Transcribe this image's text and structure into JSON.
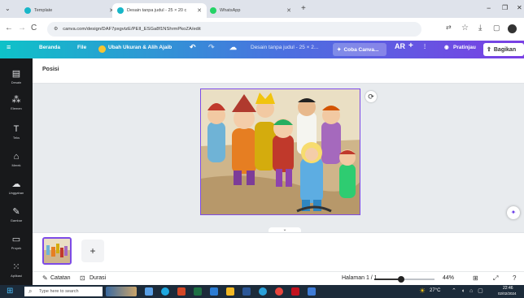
{
  "browser": {
    "tabs": [
      {
        "label": "Template",
        "active": false
      },
      {
        "label": "Desain tanpa judul - 25 × 20 c",
        "active": true
      },
      {
        "label": "WhatsApp",
        "active": false
      }
    ],
    "url": "canva.com/design/DAF7pxgvtzE/PEII_ESGa8f1NShrmPkoZA/edit",
    "window_controls": [
      "−",
      "❐",
      "✕"
    ]
  },
  "canva_toolbar": {
    "home": "Beranda",
    "file": "File",
    "resize": "Ubah Ukuran & Alih Ajaib",
    "doc_title": "Desain tanpa judul - 25 × 2...",
    "try_canva": "Coba Canva...",
    "ar": "AR",
    "plus": "+",
    "preview": "Pratinjau",
    "share": "Bagikan"
  },
  "sidebar": {
    "items": [
      {
        "icon": "layout-icon",
        "label": "Desain"
      },
      {
        "icon": "elements-icon",
        "label": "Elemen"
      },
      {
        "icon": "text-icon",
        "label": "Teks"
      },
      {
        "icon": "brand-icon",
        "label": "Merek"
      },
      {
        "icon": "upload-icon",
        "label": "Unggahan"
      },
      {
        "icon": "draw-icon",
        "label": "Gambar"
      },
      {
        "icon": "folder-icon",
        "label": "Proyek"
      },
      {
        "icon": "apps-icon",
        "label": "Aplikasi"
      }
    ]
  },
  "subbar": {
    "position": "Posisi"
  },
  "pages": {
    "add": "+"
  },
  "footer": {
    "notes": "Catatan",
    "duration": "Durasi",
    "page_indicator": "Halaman 1 / 1",
    "zoom": "44%",
    "zoom_fraction": 0.44
  },
  "taskbar": {
    "search_placeholder": "Type here to search",
    "weather": "27°C",
    "time": "22:46",
    "date": "02/02/2024"
  },
  "colors": {
    "canva_gradient_start": "#0ec2c8",
    "canva_gradient_end": "#7a3fe4",
    "rail_bg": "#18191b",
    "selection": "#7d4be6"
  }
}
